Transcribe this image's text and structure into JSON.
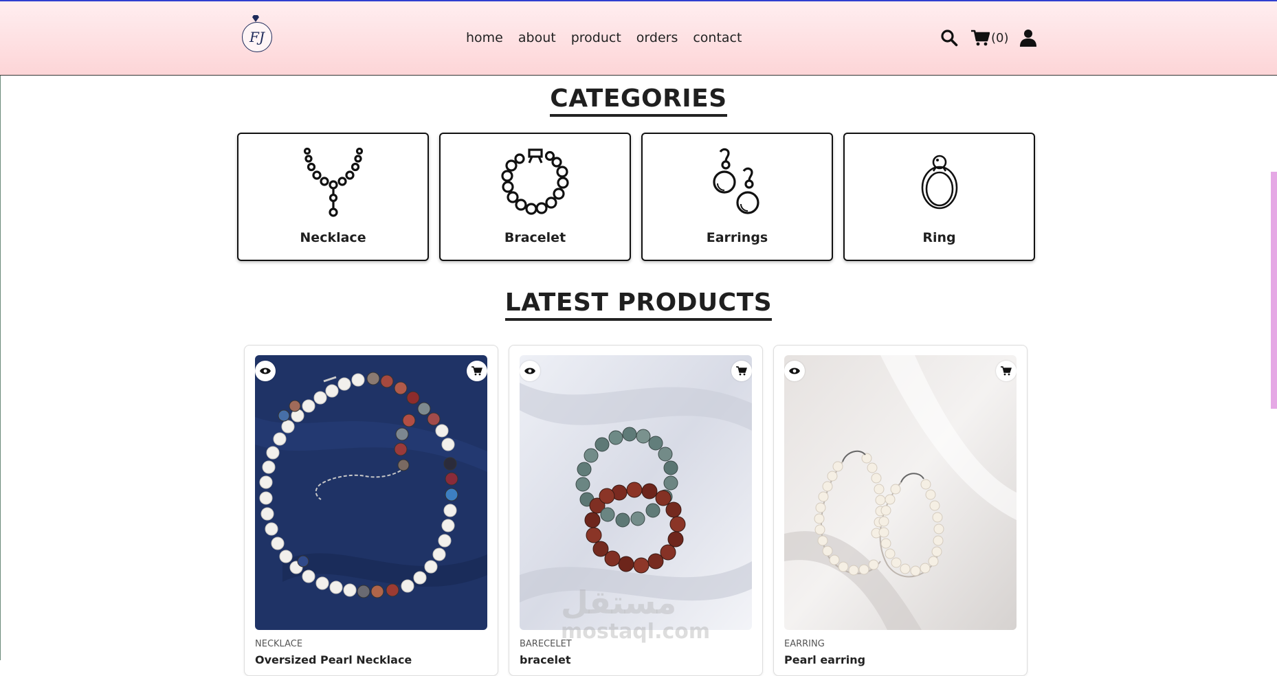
{
  "header": {
    "logo_text": "FJ",
    "nav": [
      "home",
      "about",
      "product",
      "orders",
      "contact"
    ],
    "cart_count": "(0)"
  },
  "categories": {
    "title": "CATEGORIES",
    "items": [
      {
        "label": "Necklace",
        "icon": "necklace-icon"
      },
      {
        "label": "Bracelet",
        "icon": "bracelet-icon"
      },
      {
        "label": "Earrings",
        "icon": "earrings-icon"
      },
      {
        "label": "Ring",
        "icon": "ring-icon"
      }
    ]
  },
  "latest": {
    "title": "LATEST PRODUCTS",
    "products": [
      {
        "category": "NECKLACE",
        "name": "Oversized Pearl Necklace"
      },
      {
        "category": "BARECELET",
        "name": "bracelet"
      },
      {
        "category": "EARRING",
        "name": "Pearl earring"
      }
    ]
  },
  "watermark": {
    "arabic": "مستقل",
    "latin": "mostaql.com"
  },
  "colors": {
    "header_top": "#ffeef0",
    "header_bottom": "#fdd5d7",
    "accent_line": "#2f3fd0"
  }
}
